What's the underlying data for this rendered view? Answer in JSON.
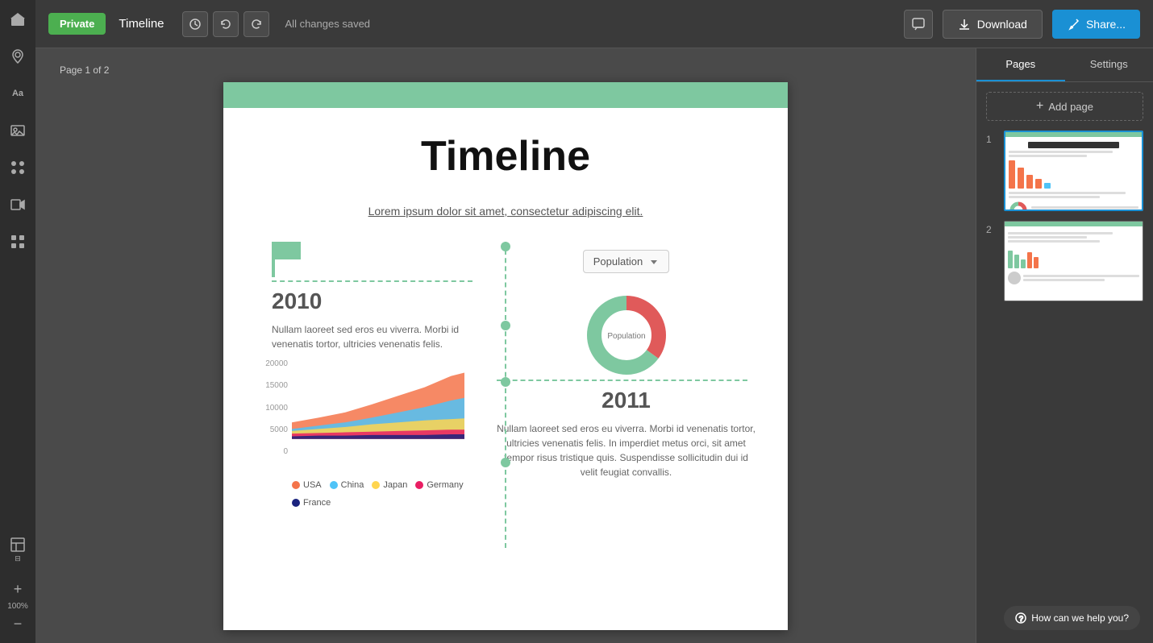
{
  "app": {
    "title": "Timeline",
    "visibility": "Private",
    "saved_status": "All changes saved"
  },
  "topbar": {
    "private_label": "Private",
    "title": "Timeline",
    "saved_text": "All changes saved",
    "download_label": "Download",
    "share_label": "Share..."
  },
  "canvas": {
    "page_label": "Page 1 of 2"
  },
  "document": {
    "title": "Timeline",
    "subtitle": "Lorem ipsum dolor sit amet, consectetur adipiscing elit.",
    "timeline_2010": {
      "year": "2010",
      "text": "Nullam laoreet sed eros eu viverra. Morbi id venenatis tortor, ultricies venenatis felis."
    },
    "timeline_2011": {
      "year": "2011",
      "text": "Nullam laoreet sed eros eu viverra. Morbi id venenatis tortor, ultricies venenatis felis. In imperdiet metus orci, sit amet tempor risus tristique quis. Suspendisse sollicitudin dui id velit feugiat convallis."
    },
    "population_dropdown": "Population",
    "chart": {
      "y_labels": [
        "20000",
        "15000",
        "10000",
        "5000",
        "0"
      ],
      "legend": [
        {
          "label": "USA",
          "color": "#f4744a"
        },
        {
          "label": "China",
          "color": "#4fc3f7"
        },
        {
          "label": "Japan",
          "color": "#ffd54f"
        },
        {
          "label": "Germany",
          "color": "#e91e63"
        },
        {
          "label": "France",
          "color": "#1a237e"
        }
      ]
    }
  },
  "right_panel": {
    "tab_pages": "Pages",
    "tab_settings": "Settings",
    "add_page_label": "Add page",
    "pages": [
      {
        "num": "1"
      },
      {
        "num": "2"
      }
    ]
  },
  "help": {
    "label": "How can we help you?"
  },
  "sidebar": {
    "icons": [
      {
        "name": "home-icon",
        "symbol": "⌂"
      },
      {
        "name": "location-icon",
        "symbol": "◎"
      },
      {
        "name": "text-icon",
        "symbol": "Aa"
      },
      {
        "name": "image-icon",
        "symbol": "▦"
      },
      {
        "name": "components-icon",
        "symbol": "✦"
      },
      {
        "name": "video-icon",
        "symbol": "▶"
      },
      {
        "name": "grid-icon",
        "symbol": "⊞"
      },
      {
        "name": "layout-icon",
        "symbol": "⊟"
      },
      {
        "name": "zoom-plus-icon",
        "symbol": "+"
      },
      {
        "name": "zoom-level-icon",
        "symbol": "100%"
      },
      {
        "name": "zoom-minus-icon",
        "symbol": "−"
      }
    ]
  }
}
